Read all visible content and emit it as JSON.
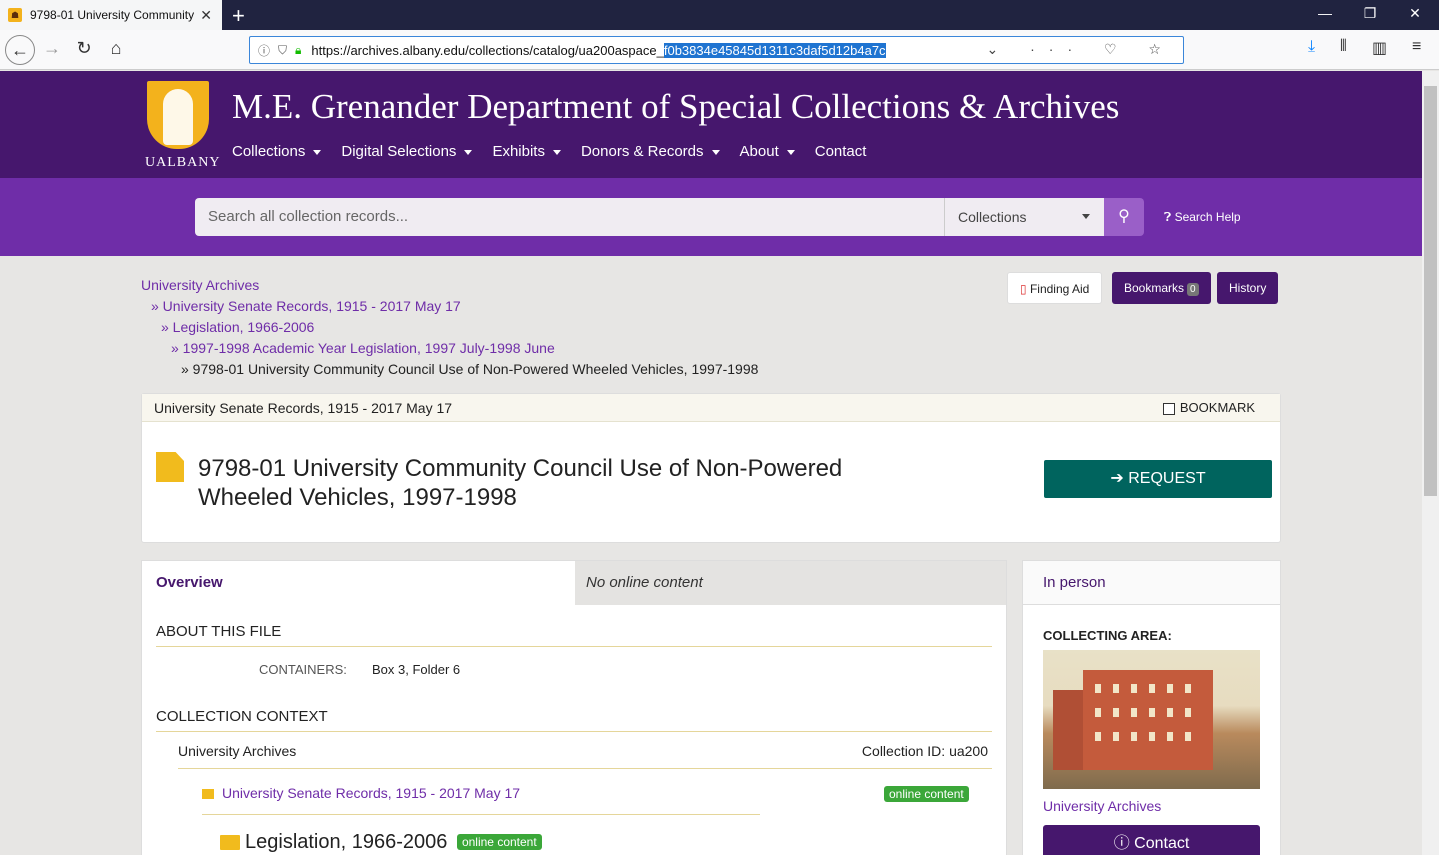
{
  "browser": {
    "tab_title": "9798-01 University Community",
    "tab_close": "✕",
    "new_tab": "+",
    "url_plain": "https://archives.albany.edu/collections/catalog/ua200aspace_",
    "url_selected": "f0b3834e45845d1311c3daf5d12b4a7c",
    "url_icons": "⌄ ··· ♡ ☆"
  },
  "site": {
    "logo_text": "UALBANY",
    "title": "M.E. Grenander Department of Special Collections & Archives",
    "nav": [
      "Collections",
      "Digital Selections",
      "Exhibits",
      "Donors & Records",
      "About",
      "Contact"
    ]
  },
  "search": {
    "placeholder": "Search all collection records...",
    "scope": "Collections",
    "help": "Search Help"
  },
  "breadcrumbs": [
    "University Archives",
    "» University Senate Records, 1915 - 2017 May 17",
    "» Legislation, 1966-2006",
    "» 1997-1998 Academic Year Legislation, 1997 July-1998 June",
    "» 9798-01 University Community Council Use of Non-Powered Wheeled Vehicles, 1997-1998"
  ],
  "tools": {
    "finding_aid": "Finding Aid",
    "bookmarks": "Bookmarks",
    "bookmarks_count": "0",
    "history": "History"
  },
  "record": {
    "collection": "University Senate Records, 1915 - 2017 May 17",
    "bookmark_label": "BOOKMARK",
    "title": "9798-01 University Community Council Use of Non-Powered Wheeled Vehicles, 1997-1998",
    "request": "REQUEST"
  },
  "panel": {
    "tab_overview": "Overview",
    "tab_online": "No online content",
    "about_heading": "ABOUT THIS FILE",
    "containers_label": "CONTAINERS:",
    "containers_value": "Box 3, Folder 6",
    "context_heading": "COLLECTION CONTEXT",
    "context_root": "University Archives",
    "collection_id": "Collection ID: ua200",
    "context_level1": "University Senate Records, 1915 - 2017 May 17",
    "online_badge": "online content",
    "context_level2": "Legislation, 1966-2006"
  },
  "side": {
    "heading": "In person",
    "collecting_area": "COLLECTING AREA:",
    "area_link": "University Archives",
    "contact": "Contact"
  }
}
